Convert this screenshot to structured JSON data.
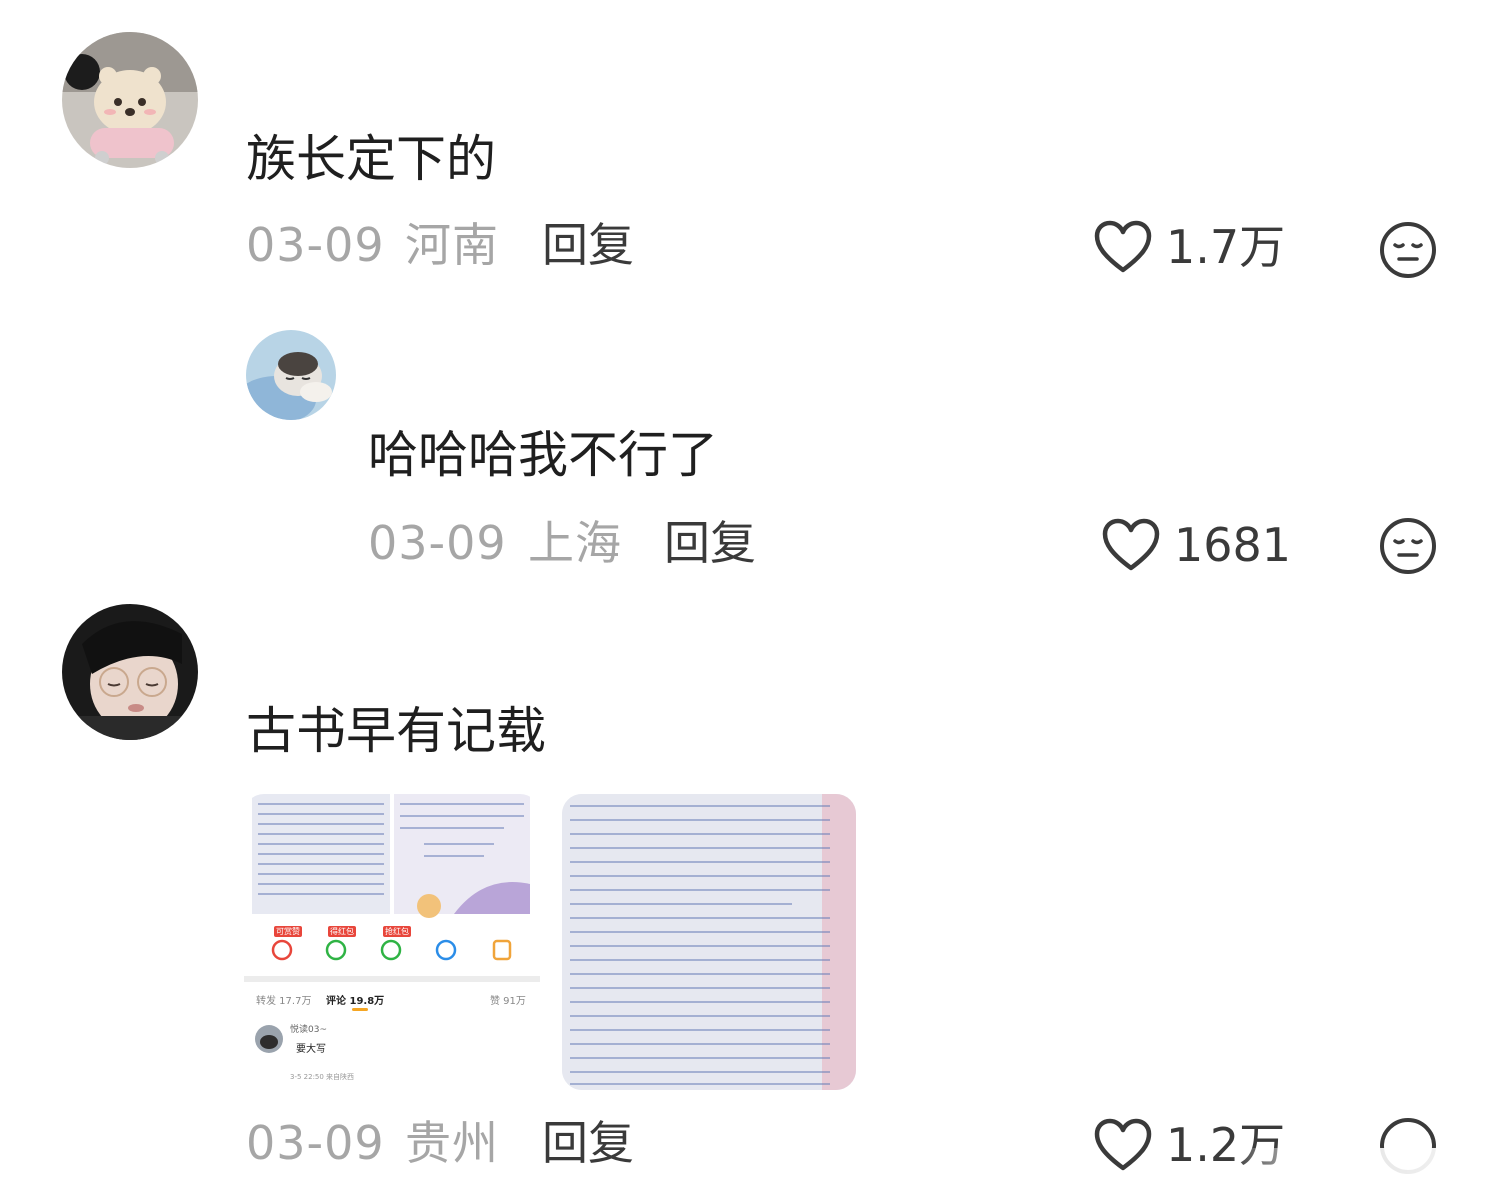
{
  "comments": [
    {
      "text": "族长定下的",
      "date": "03-09",
      "location": "河南",
      "reply_label": "回复",
      "likes": "1.7万"
    },
    {
      "text": "哈哈哈我不行了",
      "date": "03-09",
      "location": "上海",
      "reply_label": "回复",
      "likes": "1681"
    },
    {
      "text": "古书早有记载",
      "date": "03-09",
      "location": "贵州",
      "reply_label": "回复",
      "likes": "1.2万"
    }
  ],
  "attachment_screenshot": {
    "share_badges": [
      "可赏赞",
      "得红包",
      "抢红包"
    ],
    "tabs": {
      "repost": "转发 17.7万",
      "comments": "评论 19.8万",
      "likes": "赞 91万"
    },
    "inner_comment": {
      "user": "悦读03~",
      "text": "要大写",
      "meta": "3-5 22:50 来自陕西"
    }
  },
  "colors": {
    "like_icon": "#3a3a3a",
    "meta_text": "#a6a6a6",
    "main_text": "#1f1f1f",
    "accent_tab_underline": "#f5a623",
    "badge_red": "#e8463b"
  },
  "icons": {
    "like": "heart-outline-icon",
    "dislike": "neutral-face-icon"
  }
}
